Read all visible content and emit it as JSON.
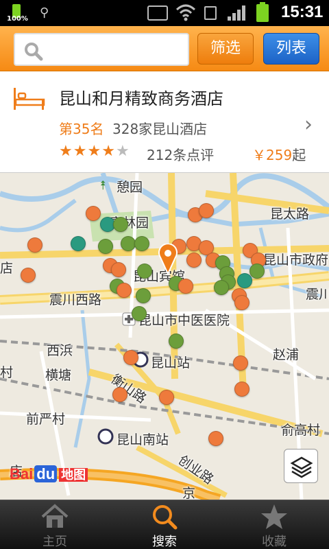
{
  "status_bar": {
    "battery_small_pct": "100%",
    "time": "15:31"
  },
  "search": {
    "placeholder": "",
    "filter_label": "筛选",
    "list_label": "列表"
  },
  "hotel": {
    "name": "昆山和月精致商务酒店",
    "rank": "第35名",
    "count": "328家昆山酒店",
    "stars_filled": 4,
    "stars_total": 5,
    "reviews": "212条点评",
    "price_symbol": "￥",
    "price_value": "259",
    "price_unit": "起"
  },
  "map": {
    "labels": {
      "park": "憩园",
      "garden": "亭林园",
      "road_kunta": "昆太路",
      "kunshan_gov": "昆山市政府",
      "dian": "店",
      "hotel_landmark": "昆山宾馆",
      "zhenchuan_west": "震川西路",
      "zhenchuan_east": "震川",
      "hospital": "昆山市中医医院",
      "xibin": "西浜",
      "zhaopu": "赵浦",
      "cun": "村",
      "hengtang": "横塘",
      "kunshan_station": "昆山站",
      "hengshan_road": "衡山路",
      "qianyan_village": "前严村",
      "yugao_village": "俞高村",
      "kunshan_south": "昆山南站",
      "chuangye_road": "创业路",
      "jing": "京",
      "dian2": "店"
    },
    "logo_text": "Bai",
    "logo_du": "du",
    "logo_map": "地图"
  },
  "nav": {
    "home": "主页",
    "search": "搜索",
    "favorites": "收藏"
  },
  "colors": {
    "accent_orange": "#ef7d1a",
    "list_blue": "#1c62c6",
    "dot_orange": "#ee7a3c",
    "dot_green": "#6c9e3b",
    "dot_teal": "#2a9a80"
  }
}
